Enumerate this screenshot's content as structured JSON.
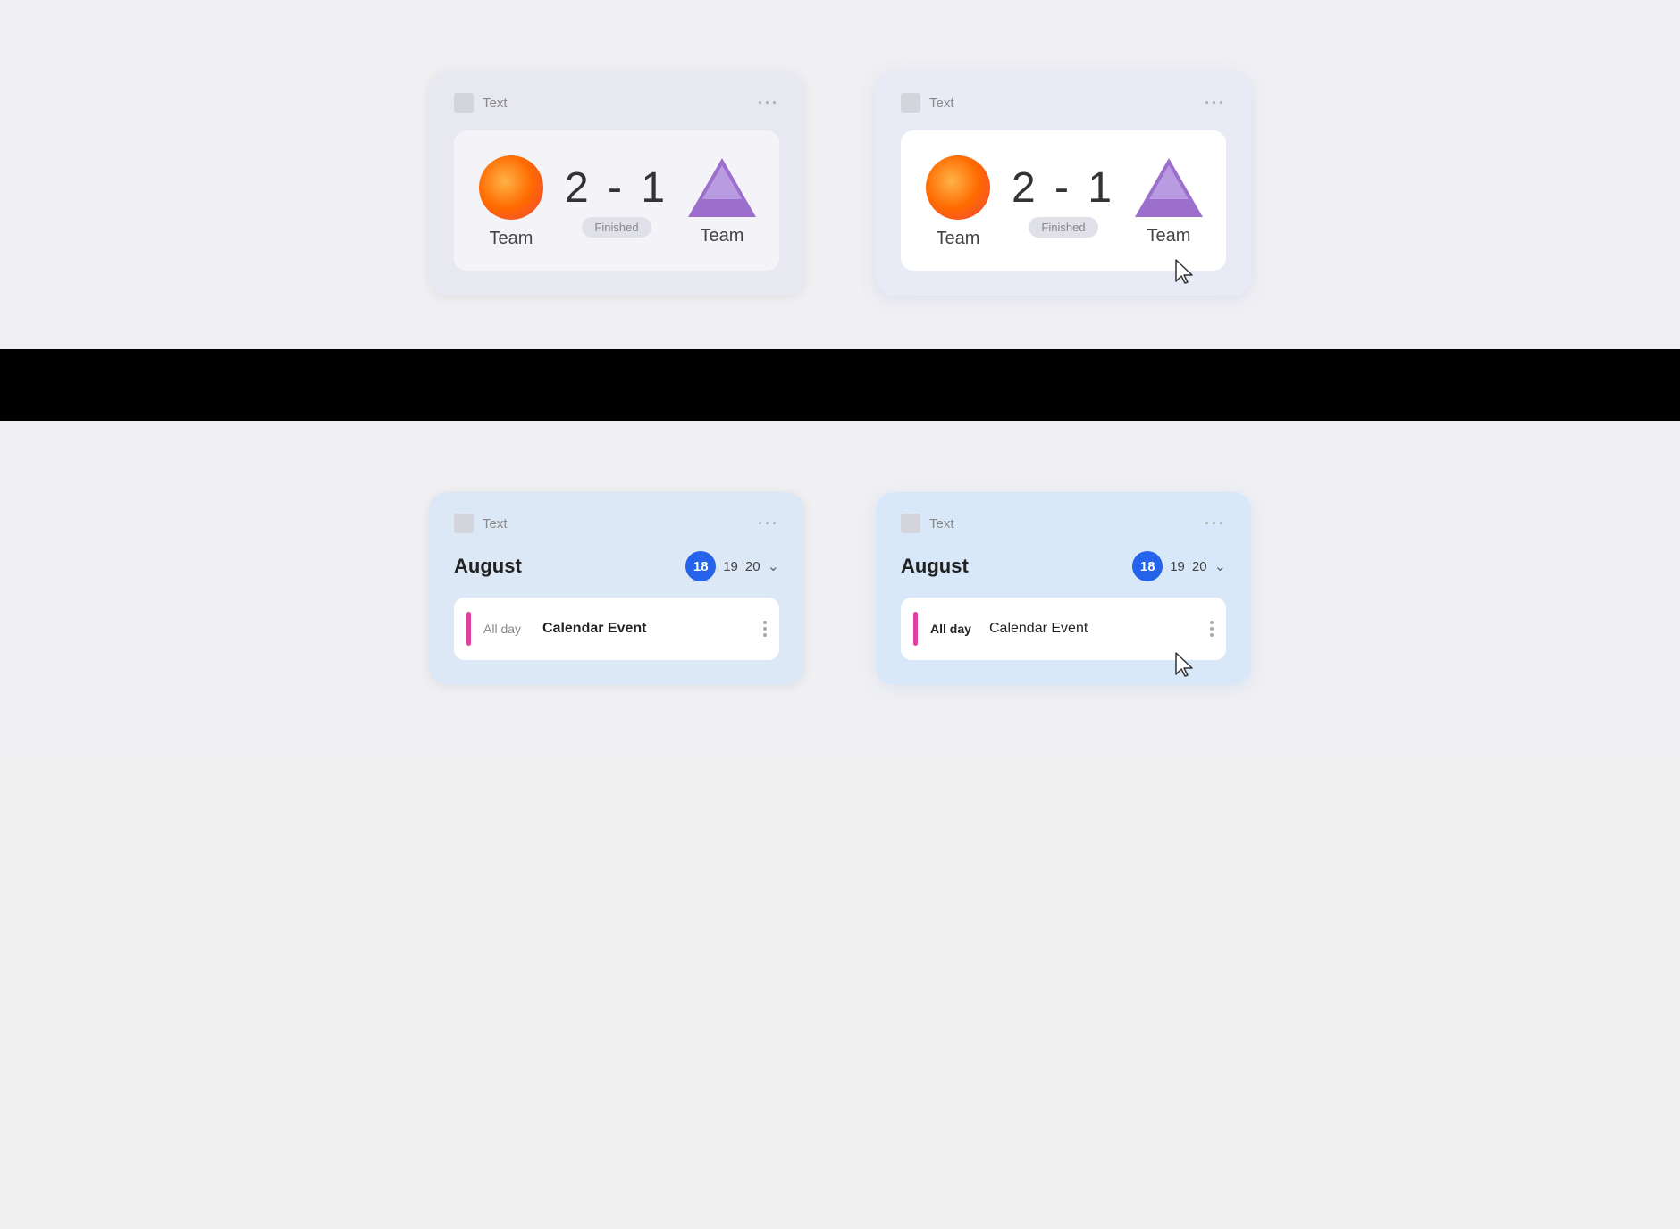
{
  "cards": {
    "score1": {
      "text_label": "Text",
      "team_a": "Team",
      "team_b": "Team",
      "score": "2 - 1",
      "status": "Finished",
      "menu": "···"
    },
    "score2": {
      "text_label": "Text",
      "team_a": "Team",
      "team_b": "Team",
      "score": "2 - 1",
      "status": "Finished",
      "menu": "···"
    },
    "calendar1": {
      "text_label": "Text",
      "month": "August",
      "day1": "18",
      "day2": "19",
      "day3": "20",
      "allday": "All day",
      "event": "Calendar Event",
      "menu": "···"
    },
    "calendar2": {
      "text_label": "Text",
      "month": "August",
      "day1": "18",
      "day2": "19",
      "day3": "20",
      "allday": "All day",
      "event": "Calendar Event",
      "menu": "···"
    }
  }
}
